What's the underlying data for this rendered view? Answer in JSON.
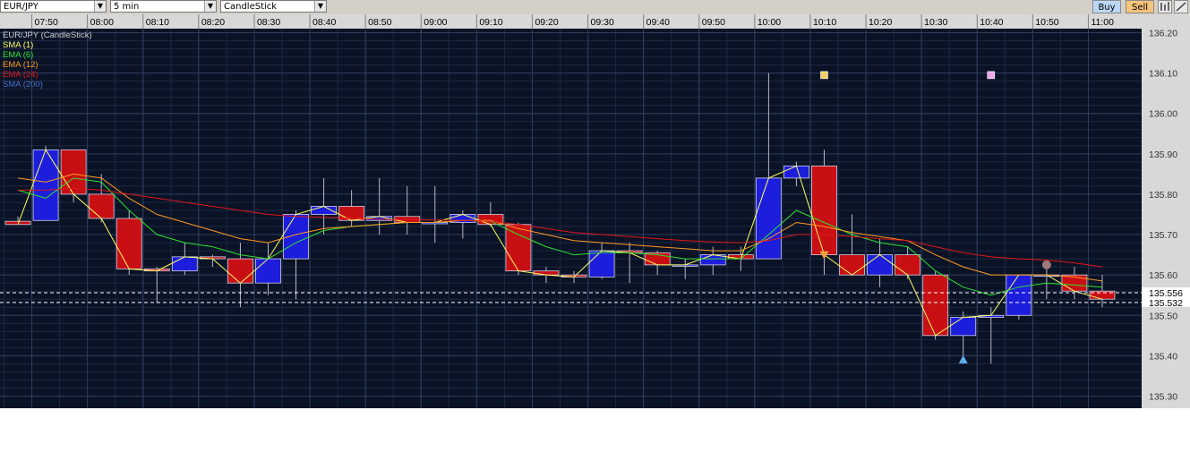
{
  "toolbar": {
    "symbol": "EUR/JPY",
    "interval": "5 min",
    "chart_style": "CandleStick",
    "buy_label": "Buy",
    "sell_label": "Sell",
    "colors": {
      "buy": "#bcd7f5",
      "sell": "#f5c37a"
    }
  },
  "chart_data": {
    "type": "candlestick",
    "x": [
      "07:45",
      "07:50",
      "07:55",
      "08:00",
      "08:05",
      "08:10",
      "08:15",
      "08:20",
      "08:25",
      "08:30",
      "08:35",
      "08:40",
      "08:45",
      "08:50",
      "08:55",
      "09:00",
      "09:05",
      "09:10",
      "09:15",
      "09:20",
      "09:25",
      "09:30",
      "09:35",
      "09:40",
      "09:45",
      "09:50",
      "09:55",
      "10:00",
      "10:05",
      "10:10",
      "10:15",
      "10:20",
      "10:25",
      "10:30",
      "10:35",
      "10:40",
      "10:45",
      "10:50",
      "10:55",
      "11:00"
    ],
    "series": [
      {
        "name": "EUR/JPY (CandleStick)",
        "candles": [
          [
            135.733,
            135.745,
            135.725,
            135.725
          ],
          [
            135.735,
            135.92,
            135.735,
            135.91
          ],
          [
            135.91,
            135.91,
            135.78,
            135.8
          ],
          [
            135.8,
            135.85,
            135.73,
            135.74
          ],
          [
            135.74,
            135.76,
            135.6,
            135.615
          ],
          [
            135.615,
            135.62,
            135.53,
            135.61
          ],
          [
            135.61,
            135.68,
            135.6,
            135.645
          ],
          [
            135.645,
            135.65,
            135.62,
            135.64
          ],
          [
            135.64,
            135.68,
            135.52,
            135.58
          ],
          [
            135.58,
            135.68,
            135.55,
            135.64
          ],
          [
            135.64,
            135.76,
            135.54,
            135.75
          ],
          [
            135.75,
            135.84,
            135.7,
            135.77
          ],
          [
            135.77,
            135.81,
            135.72,
            135.735
          ],
          [
            135.735,
            135.84,
            135.7,
            135.745
          ],
          [
            135.745,
            135.82,
            135.7,
            135.73
          ],
          [
            135.73,
            135.82,
            135.68,
            135.73
          ],
          [
            135.73,
            135.76,
            135.69,
            135.75
          ],
          [
            135.75,
            135.78,
            135.72,
            135.725
          ],
          [
            135.725,
            135.73,
            135.6,
            135.61
          ],
          [
            135.61,
            135.62,
            135.58,
            135.6
          ],
          [
            135.6,
            135.61,
            135.58,
            135.595
          ],
          [
            135.595,
            135.68,
            135.59,
            135.66
          ],
          [
            135.66,
            135.68,
            135.58,
            135.655
          ],
          [
            135.655,
            135.66,
            135.6,
            135.625
          ],
          [
            135.625,
            135.64,
            135.59,
            135.625
          ],
          [
            135.625,
            135.67,
            135.6,
            135.65
          ],
          [
            135.65,
            135.67,
            135.61,
            135.64
          ],
          [
            135.64,
            136.1,
            135.64,
            135.84
          ],
          [
            135.84,
            135.88,
            135.82,
            135.87
          ],
          [
            135.87,
            135.91,
            135.6,
            135.65
          ],
          [
            135.65,
            135.75,
            135.62,
            135.6
          ],
          [
            135.6,
            135.69,
            135.57,
            135.65
          ],
          [
            135.65,
            135.67,
            135.59,
            135.6
          ],
          [
            135.6,
            135.61,
            135.44,
            135.45
          ],
          [
            135.45,
            135.51,
            135.38,
            135.495
          ],
          [
            135.495,
            135.52,
            135.38,
            135.5
          ],
          [
            135.5,
            135.6,
            135.49,
            135.6
          ],
          [
            135.6,
            135.62,
            135.54,
            135.6
          ],
          [
            135.6,
            135.62,
            135.54,
            135.56
          ],
          [
            135.56,
            135.6,
            135.52,
            135.54
          ]
        ]
      },
      {
        "name": "SMA (1)",
        "color": "#ffff60",
        "values": [
          135.725,
          135.91,
          135.8,
          135.74,
          135.615,
          135.61,
          135.645,
          135.64,
          135.58,
          135.64,
          135.75,
          135.77,
          135.735,
          135.745,
          135.73,
          135.73,
          135.75,
          135.725,
          135.61,
          135.6,
          135.595,
          135.66,
          135.655,
          135.625,
          135.625,
          135.65,
          135.64,
          135.84,
          135.87,
          135.65,
          135.6,
          135.65,
          135.6,
          135.45,
          135.495,
          135.5,
          135.6,
          135.6,
          135.56,
          135.54
        ]
      },
      {
        "name": "EMA (6)",
        "color": "#30e030",
        "values": [
          135.81,
          135.79,
          135.84,
          135.83,
          135.76,
          135.7,
          135.68,
          135.67,
          135.65,
          135.64,
          135.68,
          135.71,
          135.72,
          135.725,
          135.73,
          135.73,
          135.735,
          135.733,
          135.7,
          135.67,
          135.65,
          135.655,
          135.655,
          135.65,
          135.64,
          135.64,
          135.64,
          135.7,
          135.76,
          135.73,
          135.7,
          135.68,
          135.67,
          135.61,
          135.57,
          135.55,
          135.57,
          135.58,
          135.575,
          135.57
        ]
      },
      {
        "name": "EMA (12)",
        "color": "#ff9a20",
        "values": [
          135.84,
          135.83,
          135.85,
          135.84,
          135.79,
          135.75,
          135.73,
          135.71,
          135.69,
          135.68,
          135.7,
          135.715,
          135.72,
          135.725,
          135.73,
          135.73,
          135.735,
          135.735,
          135.715,
          135.7,
          135.685,
          135.68,
          135.675,
          135.67,
          135.665,
          135.66,
          135.66,
          135.69,
          135.73,
          135.72,
          135.705,
          135.695,
          135.685,
          135.65,
          135.62,
          135.6,
          135.6,
          135.6,
          135.595,
          135.585
        ]
      },
      {
        "name": "EMA (24)",
        "color": "#e01818",
        "values": [
          135.81,
          135.81,
          135.815,
          135.81,
          135.8,
          135.79,
          135.78,
          135.77,
          135.76,
          135.75,
          135.745,
          135.743,
          135.74,
          135.738,
          135.737,
          135.736,
          135.735,
          135.733,
          135.725,
          135.715,
          135.705,
          135.7,
          135.695,
          135.69,
          135.685,
          135.682,
          135.68,
          135.685,
          135.7,
          135.7,
          135.695,
          135.69,
          135.685,
          135.67,
          135.655,
          135.645,
          135.64,
          135.637,
          135.63,
          135.62
        ]
      },
      {
        "name": "SMA (200)",
        "color": "#4a6fd0",
        "values": []
      }
    ],
    "markers": [
      {
        "x": "10:10",
        "y": 136.095,
        "shape": "square",
        "color": "#f0d060"
      },
      {
        "x": "10:40",
        "y": 136.095,
        "shape": "square",
        "color": "#f0a8e8"
      },
      {
        "x": "10:10",
        "y": 135.65,
        "shape": "triangle-down",
        "color": "#f0a040"
      },
      {
        "x": "10:35",
        "y": 135.39,
        "shape": "triangle-up",
        "color": "#60b0f0"
      },
      {
        "x": "10:50",
        "y": 135.625,
        "shape": "circle",
        "color": "#a07878"
      }
    ],
    "price_levels": [
      135.556,
      135.532
    ],
    "time_ticks": [
      "07:50",
      "08:00",
      "08:10",
      "08:20",
      "08:30",
      "08:40",
      "08:50",
      "09:00",
      "09:10",
      "09:20",
      "09:30",
      "09:40",
      "09:50",
      "10:00",
      "10:10",
      "10:20",
      "10:30",
      "10:40",
      "10:50",
      "11:00"
    ],
    "price_ticks": [
      "135.30",
      "135.40",
      "135.50",
      "135.60",
      "135.70",
      "135.80",
      "135.90",
      "136.00",
      "136.10",
      "136.20"
    ],
    "ylim": [
      135.27,
      136.21
    ],
    "grid": true,
    "legend": "top-left"
  }
}
